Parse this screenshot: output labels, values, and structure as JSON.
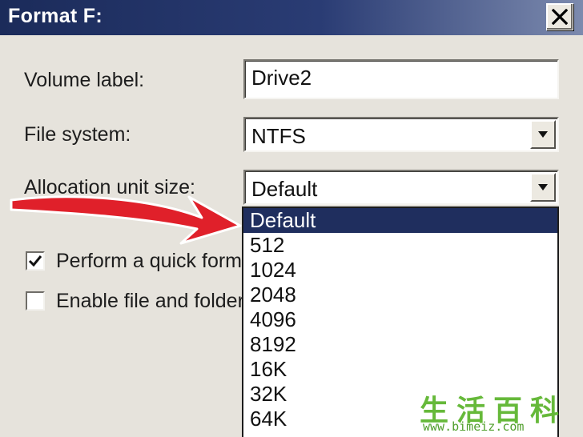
{
  "window": {
    "title": "Format F:",
    "close_glyph": "✕"
  },
  "form": {
    "volume_label": {
      "label": "Volume label:",
      "value": "Drive2"
    },
    "file_system": {
      "label": "File system:",
      "value": "NTFS"
    },
    "allocation": {
      "label": "Allocation unit size:",
      "value": "Default"
    }
  },
  "options": {
    "quick_format": {
      "label": "Perform a quick format",
      "checked": true
    },
    "compression": {
      "label": "Enable file and folder compression",
      "checked": false
    }
  },
  "dropdown": {
    "selected_index": 0,
    "items": [
      "Default",
      "512",
      "1024",
      "2048",
      "4096",
      "8192",
      "16K",
      "32K",
      "64K"
    ]
  },
  "annotation": {
    "arrow_color": "#e0202a"
  },
  "watermark": {
    "chars": "生活百科",
    "url": "www.bimeiz.com"
  },
  "colors": {
    "titlebar": "#1b2b5a",
    "selection": "#1f2e5e",
    "dialog_bg": "#e6e3dc",
    "watermark": "#66b93a"
  }
}
